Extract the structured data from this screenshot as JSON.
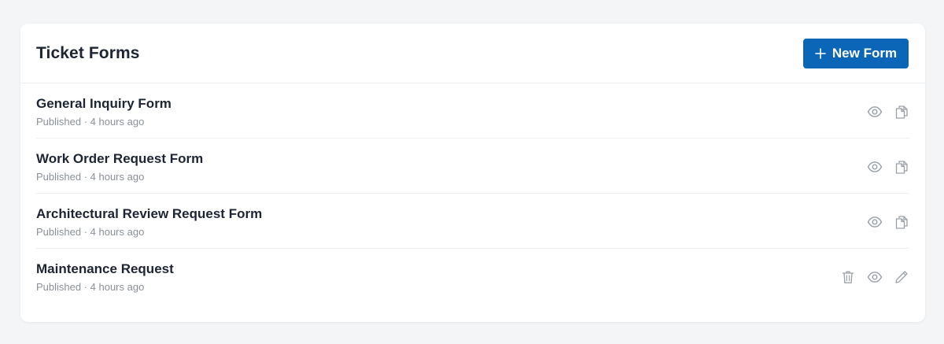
{
  "header": {
    "title": "Ticket Forms",
    "new_button_label": "New Form"
  },
  "colors": {
    "accent": "#0b66b8",
    "icon": "#9aa0a8"
  },
  "forms": [
    {
      "title": "General Inquiry Form",
      "status": "Published",
      "time": "4 hours ago",
      "meta": "Published · 4 hours ago",
      "actions": [
        "eye-icon",
        "copy-icon"
      ]
    },
    {
      "title": "Work Order Request Form",
      "status": "Published",
      "time": "4 hours ago",
      "meta": "Published · 4 hours ago",
      "actions": [
        "eye-icon",
        "copy-icon"
      ]
    },
    {
      "title": "Architectural Review Request Form",
      "status": "Published",
      "time": "4 hours ago",
      "meta": "Published · 4 hours ago",
      "actions": [
        "eye-icon",
        "copy-icon"
      ]
    },
    {
      "title": "Maintenance Request",
      "status": "Published",
      "time": "4 hours ago",
      "meta": "Published · 4 hours ago",
      "actions": [
        "trash-icon",
        "eye-icon",
        "edit-icon"
      ]
    }
  ]
}
